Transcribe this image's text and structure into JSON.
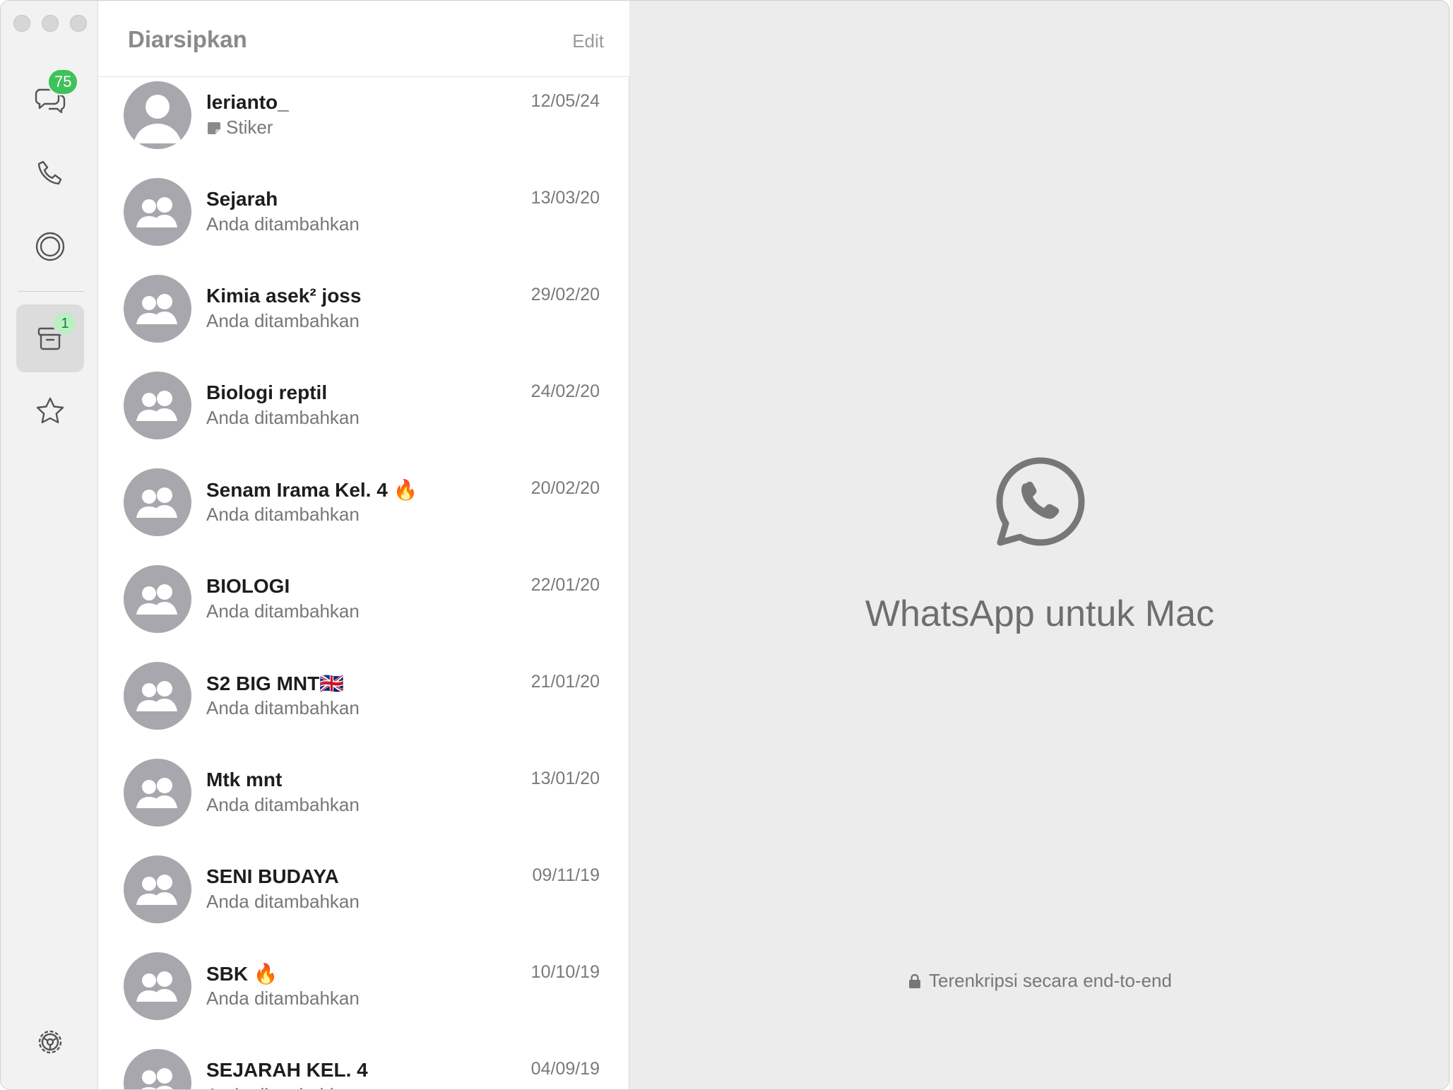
{
  "rail": {
    "chats_badge": "75",
    "archive_badge": "1",
    "icons": [
      "chats-icon",
      "calls-icon",
      "status-icon",
      "archive-icon",
      "starred-icon",
      "settings-icon"
    ]
  },
  "list": {
    "title": "Diarsipkan",
    "edit_label": "Edit",
    "chats": [
      {
        "name": "lerianto_",
        "date": "12/05/24",
        "subtitle": "Stiker",
        "type": "contact",
        "sticker": true
      },
      {
        "name": "Sejarah",
        "date": "13/03/20",
        "subtitle": "Anda ditambahkan",
        "type": "group"
      },
      {
        "name": "Kimia asek² joss",
        "date": "29/02/20",
        "subtitle": "Anda ditambahkan",
        "type": "group"
      },
      {
        "name": "Biologi reptil",
        "date": "24/02/20",
        "subtitle": "Anda ditambahkan",
        "type": "group"
      },
      {
        "name": "Senam Irama Kel. 4 🔥",
        "date": "20/02/20",
        "subtitle": "Anda ditambahkan",
        "type": "group"
      },
      {
        "name": "BIOLOGI",
        "date": "22/01/20",
        "subtitle": "Anda ditambahkan",
        "type": "group"
      },
      {
        "name": "S2 BIG MNT🇬🇧",
        "date": "21/01/20",
        "subtitle": "Anda ditambahkan",
        "type": "group"
      },
      {
        "name": "Mtk mnt",
        "date": "13/01/20",
        "subtitle": "Anda ditambahkan",
        "type": "group"
      },
      {
        "name": "SENI BUDAYA",
        "date": "09/11/19",
        "subtitle": "Anda ditambahkan",
        "type": "group"
      },
      {
        "name": "SBK 🔥",
        "date": "10/10/19",
        "subtitle": "Anda ditambahkan",
        "type": "group"
      },
      {
        "name": "SEJARAH KEL. 4",
        "date": "04/09/19",
        "subtitle": "Anda ditambahkan",
        "type": "group"
      }
    ]
  },
  "main": {
    "title": "WhatsApp untuk Mac",
    "encryption_note": "Terenkripsi secara end-to-end"
  },
  "colors": {
    "badge_green": "#3ec25a",
    "avatar_gray": "#a7a7ad",
    "pane_bg": "#ececec"
  }
}
